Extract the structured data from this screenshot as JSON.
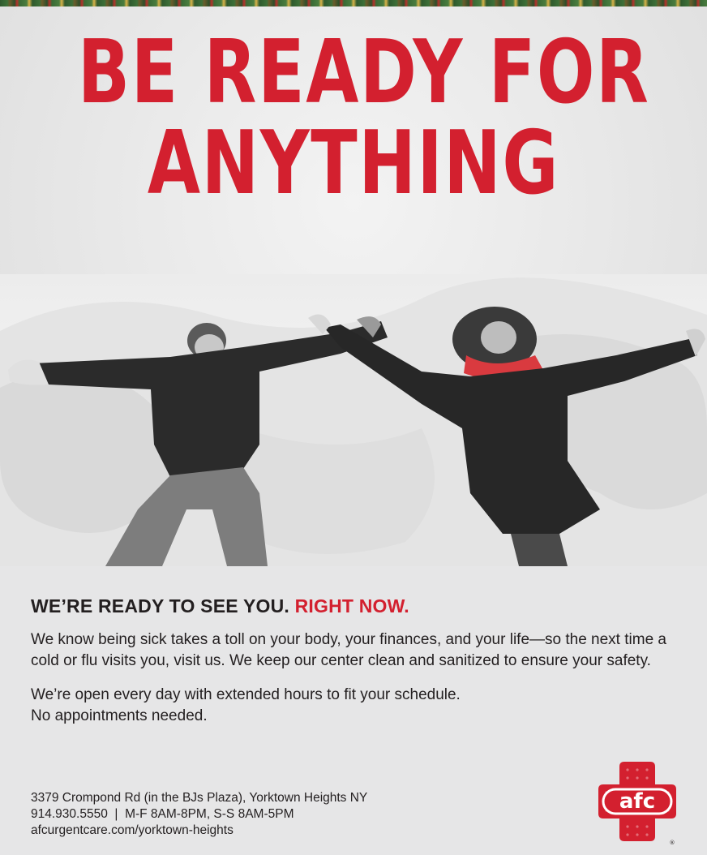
{
  "headline": {
    "line1": "BE READY FOR",
    "line2": "ANYTHING"
  },
  "subhead": {
    "black": "WE’RE READY TO SEE YOU.",
    "red": "RIGHT NOW."
  },
  "body": {
    "paragraph1": "We know being sick takes a toll on your body, your finances, and your life—so the next time a cold or flu visits you, visit us. We keep our center clean and sanitized to ensure your safety.",
    "paragraph2_line1": "We’re open every day with extended hours to fit your schedule.",
    "paragraph2_line2": "No appointments needed."
  },
  "footer": {
    "address": "3379 Crompond Rd (in the BJs Plaza), Yorktown Heights NY",
    "phone_hours": "914.930.5550  |  M-F 8AM-8PM, S-S 8AM-5PM",
    "website": "afcurgentcare.com/yorktown-heights"
  },
  "logo": {
    "text": "afc",
    "registered_mark": "®"
  },
  "colors": {
    "brand_red": "#d3202f",
    "text": "#231f20",
    "background": "#e6e6e7"
  },
  "image": {
    "subject_icon": "snow-angels-photo-icon"
  }
}
